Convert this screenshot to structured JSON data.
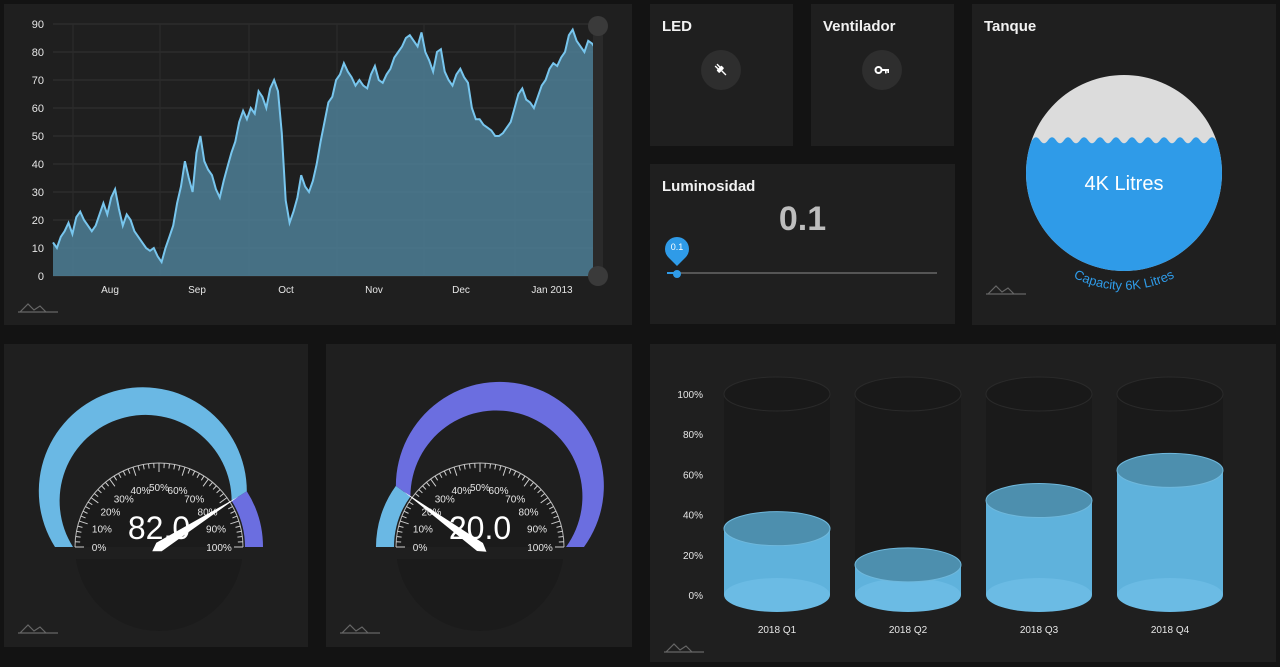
{
  "area_chart": {
    "y_ticks": [
      "90",
      "80",
      "70",
      "60",
      "50",
      "40",
      "30",
      "20",
      "10",
      "0"
    ],
    "x_ticks": [
      "Aug",
      "Sep",
      "Oct",
      "Nov",
      "Dec",
      "Jan 2013"
    ]
  },
  "led": {
    "title": "LED",
    "icon": "plug-icon"
  },
  "fan": {
    "title": "Ventilador",
    "icon": "key-icon"
  },
  "luminosity": {
    "title": "Luminosidad",
    "value": "0.1",
    "slider_label": "0.1",
    "slider_fraction": 0.1
  },
  "tank": {
    "title": "Tanque",
    "label": "4K Litres",
    "capacity_label": "Capacity 6K Litres",
    "fill_fraction": 0.667
  },
  "gauge1": {
    "value": "82.0",
    "level": 82,
    "ticks": [
      "0%",
      "10%",
      "20%",
      "30%",
      "40%",
      "50%",
      "60%",
      "70%",
      "80%",
      "90%",
      "100%"
    ]
  },
  "gauge2": {
    "value": "20.0",
    "level": 20,
    "ticks": [
      "0%",
      "10%",
      "20%",
      "30%",
      "40%",
      "50%",
      "60%",
      "70%",
      "80%",
      "90%",
      "100%"
    ]
  },
  "colors": {
    "accent_blue": "#2f9be8",
    "light_blue": "#6ab8e4",
    "purple": "#6b6ee0",
    "area_fill": "#4d7f97",
    "card": "#1f1f1f",
    "background": "#131313"
  },
  "chart_data": [
    {
      "type": "area",
      "x": [
        "Aug",
        "Sep",
        "Oct",
        "Nov",
        "Dec",
        "Jan 2013"
      ],
      "ylim": [
        0,
        90
      ],
      "grid": true,
      "series": [
        {
          "values": [
            12,
            10,
            14,
            16,
            19,
            15,
            21,
            23,
            20,
            18,
            16,
            18,
            22,
            26,
            22,
            28,
            31,
            24,
            18,
            22,
            20,
            16,
            14,
            12,
            10,
            9,
            10,
            7,
            5,
            10,
            14,
            18,
            26,
            32,
            41,
            35,
            30,
            44,
            50,
            41,
            38,
            36,
            31,
            28,
            34,
            39,
            44,
            48,
            55,
            59,
            56,
            60,
            58,
            66,
            64,
            60,
            67,
            70,
            66,
            51,
            27,
            19,
            23,
            28,
            36,
            32,
            30,
            34,
            40,
            48,
            55,
            62,
            64,
            70,
            72,
            76,
            73,
            71,
            68,
            70,
            68,
            67,
            72,
            75,
            70,
            69,
            72,
            74,
            78,
            80,
            82,
            85,
            86,
            84,
            82,
            87,
            80,
            77,
            73,
            80,
            81,
            73,
            70,
            68,
            72,
            74,
            71,
            69,
            60,
            56,
            56,
            54,
            53,
            52,
            50,
            50,
            51,
            53,
            55,
            60,
            65,
            67,
            63,
            62,
            60,
            64,
            68,
            70,
            74,
            76,
            75,
            78,
            80,
            86,
            88,
            84,
            82,
            80,
            84,
            83,
            81
          ]
        }
      ]
    },
    {
      "type": "bar",
      "categories": [
        "2018 Q1",
        "2018 Q2",
        "2018 Q3",
        "2018 Q4"
      ],
      "y_ticks": [
        "100%",
        "80%",
        "60%",
        "40%",
        "20%",
        "0%"
      ],
      "values": [
        33,
        15,
        47,
        62
      ],
      "ylim": [
        0,
        100
      ]
    }
  ]
}
